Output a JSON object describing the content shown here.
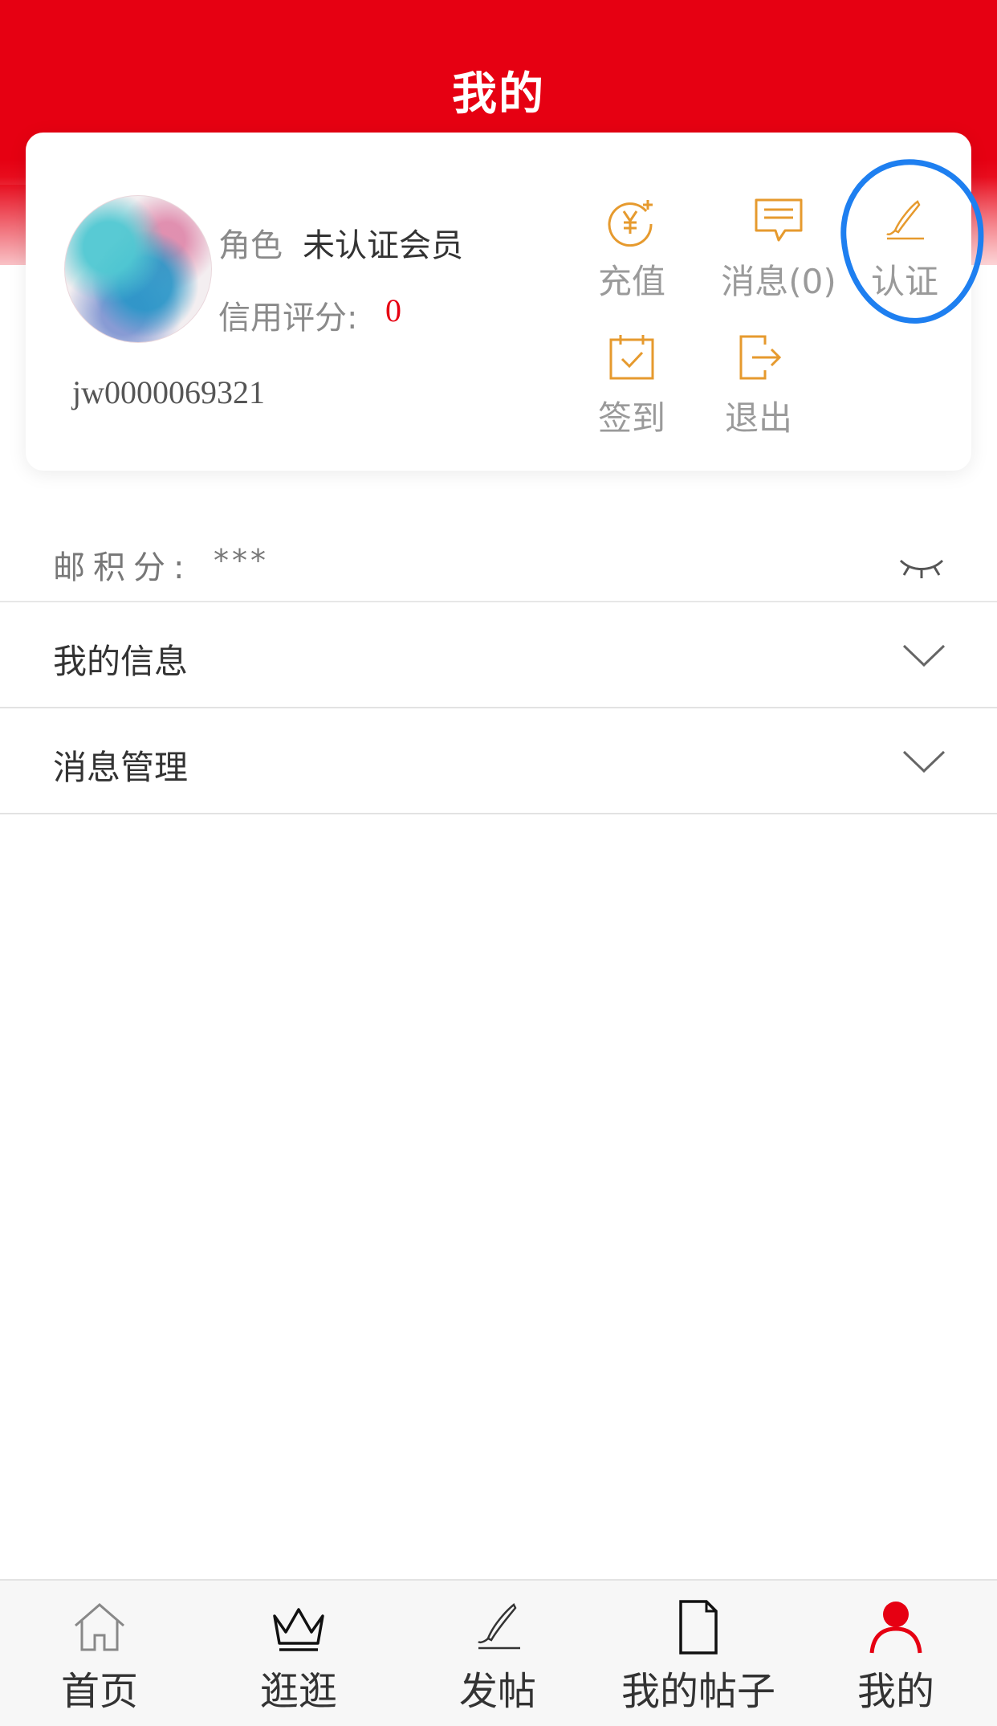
{
  "header": {
    "title": "我的"
  },
  "profile": {
    "role_label": "角色",
    "role_value": "未认证会员",
    "credit_label": "信用评分:",
    "credit_value": "0",
    "username": "jw0000069321"
  },
  "actions": {
    "recharge": {
      "label": "充值",
      "icon": "yen-plus-icon"
    },
    "messages": {
      "label": "消息(0)",
      "icon": "message-icon"
    },
    "auth": {
      "label": "认证",
      "icon": "pen-icon"
    },
    "signin": {
      "label": "签到",
      "icon": "calendar-check-icon"
    },
    "logout": {
      "label": "退出",
      "icon": "logout-icon"
    }
  },
  "points": {
    "label": "邮积分:",
    "value": "***"
  },
  "menu": {
    "items": [
      {
        "label": "我的信息"
      },
      {
        "label": "消息管理"
      }
    ]
  },
  "tabbar": {
    "items": [
      {
        "label": "首页",
        "icon": "home-icon"
      },
      {
        "label": "逛逛",
        "icon": "crown-icon"
      },
      {
        "label": "发帖",
        "icon": "pen-icon"
      },
      {
        "label": "我的帖子",
        "icon": "document-icon"
      },
      {
        "label": "我的",
        "icon": "user-icon"
      }
    ],
    "active": "我的"
  },
  "colors": {
    "brand_red": "#e60012",
    "accent_orange": "#e69a2e",
    "annotation_blue": "#1e7ff0"
  }
}
